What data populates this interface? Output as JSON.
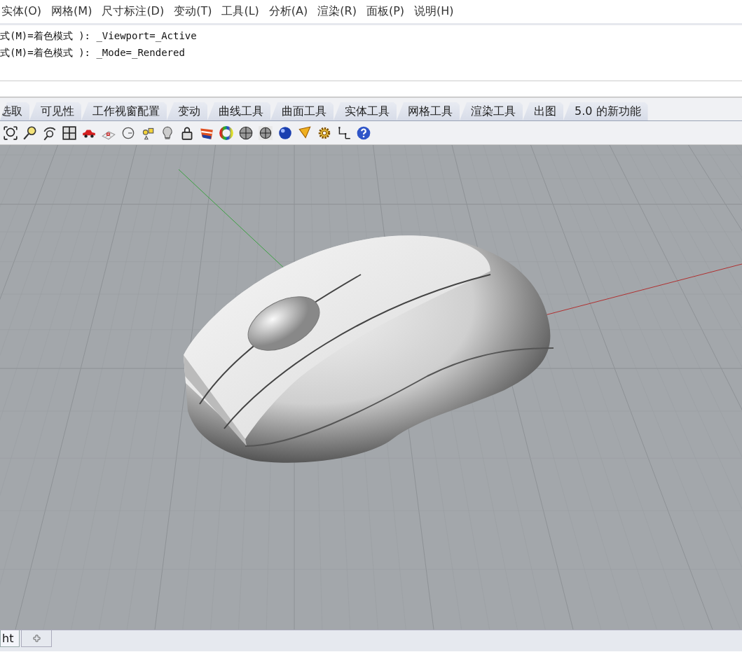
{
  "menu_bar": [
    "实体(O)",
    "网格(M)",
    "尺寸标注(D)",
    "变动(T)",
    "工具(L)",
    "分析(A)",
    "渲染(R)",
    "面板(P)",
    "说明(H)"
  ],
  "command_history": [
    "式(M)=着色模式 ): _Viewport=_Active",
    "式(M)=着色模式 ): _Mode=_Rendered"
  ],
  "toolbar_tabs": [
    {
      "label": "选取",
      "selected": false
    },
    {
      "label": "可见性",
      "selected": false
    },
    {
      "label": "工作视窗配置",
      "selected": false
    },
    {
      "label": "变动",
      "selected": false
    },
    {
      "label": "曲线工具",
      "selected": false
    },
    {
      "label": "曲面工具",
      "selected": false
    },
    {
      "label": "实体工具",
      "selected": false
    },
    {
      "label": "网格工具",
      "selected": false
    },
    {
      "label": "渲染工具",
      "selected": false
    },
    {
      "label": "出图",
      "selected": false
    },
    {
      "label": "5.0 的新功能",
      "selected": false
    }
  ],
  "viewport_tabs": [
    {
      "label": "ht",
      "selected": true
    }
  ]
}
